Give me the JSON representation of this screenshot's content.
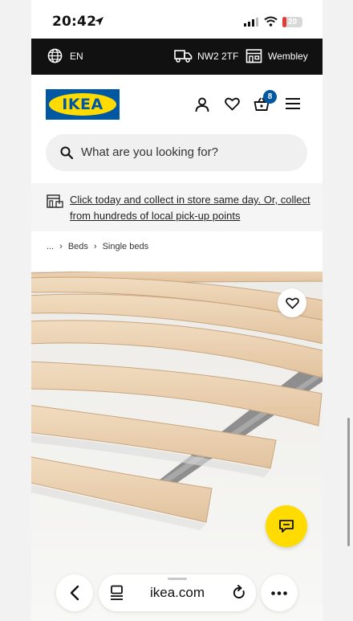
{
  "status_bar": {
    "time": "20:42",
    "battery": "20",
    "battery_level": 0.2
  },
  "topbar": {
    "language": "EN",
    "postcode": "NW2 2TF",
    "store": "Wembley"
  },
  "header": {
    "logo_text": "IKEA",
    "basket_count": "8",
    "search_placeholder": "What are you looking for?",
    "brand_colors": {
      "blue": "#0058a3",
      "yellow": "#ffdb00"
    }
  },
  "notice": {
    "text": "Click today and collect in store same day. Or, collect from hundreds of local pick-up points"
  },
  "breadcrumb": {
    "ellipsis": "...",
    "items": [
      "Beds",
      "Single beds"
    ]
  },
  "product": {
    "icons": [
      "heart-icon",
      "chat-icon"
    ]
  },
  "browser": {
    "url": "ikea.com"
  }
}
